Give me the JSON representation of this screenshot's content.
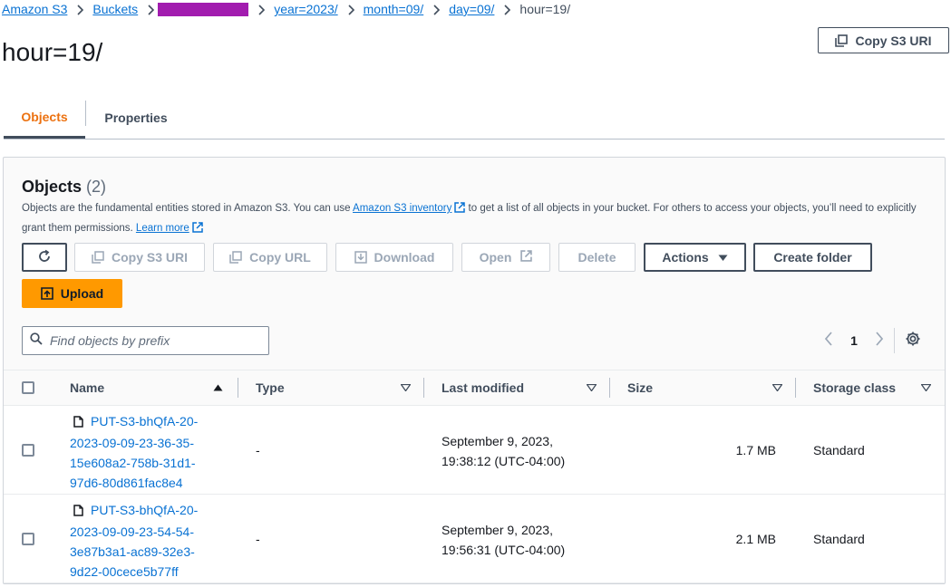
{
  "breadcrumb": {
    "items": [
      "Amazon S3",
      "Buckets",
      "year=2023/",
      "month=09/",
      "day=09/"
    ],
    "current": "hour=19/"
  },
  "page": {
    "title": "hour=19/",
    "copy_s3_uri_label": "Copy S3 URI"
  },
  "tabs": [
    {
      "label": "Objects",
      "active": true
    },
    {
      "label": "Properties",
      "active": false
    }
  ],
  "objects_panel": {
    "title": "Objects",
    "count": "(2)",
    "description_part1": "Objects are the fundamental entities stored in Amazon S3. You can use ",
    "inventory_link": "Amazon S3 inventory",
    "description_part2": " to get a list of all objects in your bucket. For others to access your objects, you’ll need to explicitly grant them permissions. ",
    "learn_more_link": "Learn more"
  },
  "toolbar": {
    "copy_s3_uri": "Copy S3 URI",
    "copy_url": "Copy URL",
    "download": "Download",
    "open": "Open",
    "delete": "Delete",
    "actions": "Actions",
    "create_folder": "Create folder",
    "upload": "Upload"
  },
  "search": {
    "placeholder": "Find objects by prefix",
    "value": ""
  },
  "pagination": {
    "current_page": "1"
  },
  "table": {
    "columns": [
      "Name",
      "Type",
      "Last modified",
      "Size",
      "Storage class"
    ],
    "rows": [
      {
        "name_lines": [
          "PUT-S3-bhQfA-20-",
          "2023-09-09-23-36-35-",
          "15e608a2-758b-31d1-",
          "97d6-80d861fac8e4"
        ],
        "type": "-",
        "modified_lines": [
          "September 9, 2023,",
          "19:38:12 (UTC-04:00)"
        ],
        "size": "1.7 MB",
        "storage_class": "Standard"
      },
      {
        "name_lines": [
          "PUT-S3-bhQfA-20-",
          "2023-09-09-23-54-54-",
          "3e87b3a1-ac89-32e3-",
          "9d22-00cece5b77ff"
        ],
        "type": "-",
        "modified_lines": [
          "September 9, 2023,",
          "19:56:31 (UTC-04:00)"
        ],
        "size": "2.1 MB",
        "storage_class": "Standard"
      }
    ]
  },
  "colors": {
    "link": "#0972d3",
    "active_tab": "#ec7211",
    "primary_button": "#ff9900",
    "redaction": "#a21caf"
  },
  "icons": [
    "chevron-right-icon",
    "copy-icon",
    "refresh-icon",
    "download-icon",
    "external-link-icon",
    "caret-down-icon",
    "upload-icon",
    "search-icon",
    "chevron-left-icon",
    "gear-icon",
    "sort-ascending-icon",
    "sort-icon",
    "file-icon"
  ]
}
